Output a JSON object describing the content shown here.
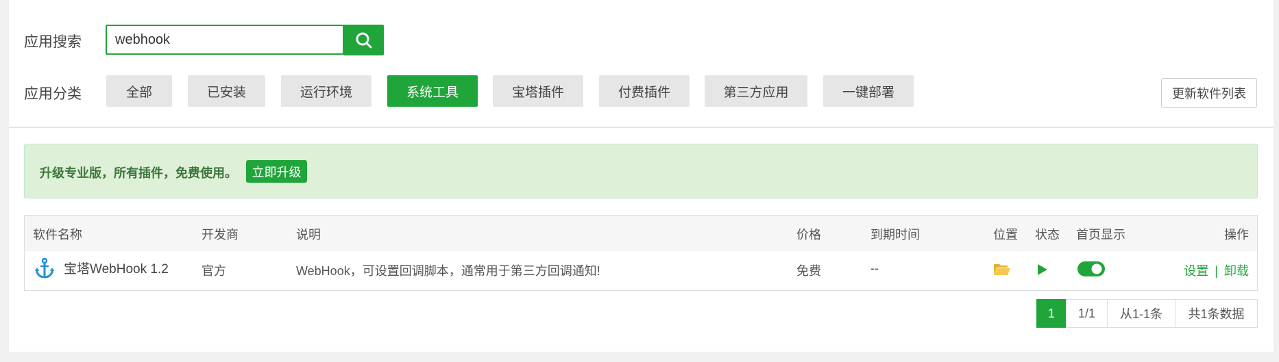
{
  "search": {
    "label": "应用搜索",
    "value": "webhook"
  },
  "categories": {
    "label": "应用分类",
    "items": [
      "全部",
      "已安装",
      "运行环境",
      "系统工具",
      "宝塔插件",
      "付费插件",
      "第三方应用",
      "一键部署"
    ],
    "active": "系统工具",
    "refresh_label": "更新软件列表"
  },
  "promo": {
    "text": "升级专业版，所有插件，免费使用。",
    "button": "立即升级"
  },
  "table": {
    "headers": [
      "软件名称",
      "开发商",
      "说明",
      "价格",
      "到期时间",
      "位置",
      "状态",
      "首页显示",
      "操作"
    ],
    "rows": [
      {
        "name": "宝塔WebHook 1.2",
        "developer": "官方",
        "description": "WebHook，可设置回调脚本，通常用于第三方回调通知!",
        "price": "免费",
        "expiry": "--",
        "location_icon": "folder-icon",
        "status_icon": "play-icon",
        "homepage_display": true,
        "action_settings": "设置",
        "action_separator": "|",
        "action_uninstall": "卸载"
      }
    ]
  },
  "pagination": {
    "current": "1",
    "pages": "1/1",
    "range": "从1-1条",
    "total": "共1条数据"
  },
  "colors": {
    "accent": "#20a53a",
    "promo_bg": "#dff0d8",
    "folder": "#f0c040"
  }
}
